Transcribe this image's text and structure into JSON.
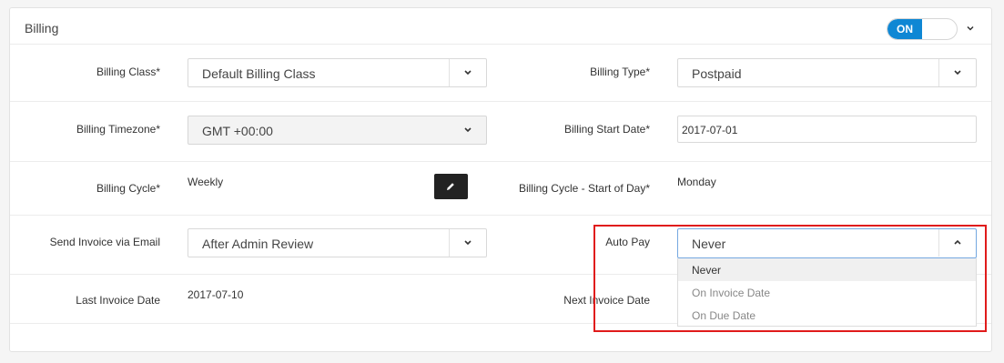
{
  "panel": {
    "title": "Billing",
    "toggle_label": "ON"
  },
  "fields": {
    "billing_class": {
      "label": "Billing Class*",
      "value": "Default Billing Class"
    },
    "billing_type": {
      "label": "Billing Type*",
      "value": "Postpaid"
    },
    "billing_timezone": {
      "label": "Billing Timezone*",
      "value": "GMT +00:00"
    },
    "billing_start_date": {
      "label": "Billing Start Date*",
      "value": "2017-07-01"
    },
    "billing_cycle": {
      "label": "Billing Cycle*",
      "value": "Weekly"
    },
    "cycle_start_day": {
      "label": "Billing Cycle - Start of Day*",
      "value": "Monday"
    },
    "send_invoice": {
      "label": "Send Invoice via Email",
      "value": "After Admin Review"
    },
    "auto_pay": {
      "label": "Auto Pay",
      "value": "Never"
    },
    "last_invoice_date": {
      "label": "Last Invoice Date",
      "value": "2017-07-10"
    },
    "next_invoice_date": {
      "label": "Next Invoice Date"
    }
  },
  "auto_pay_options": [
    "Never",
    "On Invoice Date",
    "On Due Date"
  ],
  "colors": {
    "accent": "#0f87d4",
    "highlight": "#e01b1b"
  }
}
